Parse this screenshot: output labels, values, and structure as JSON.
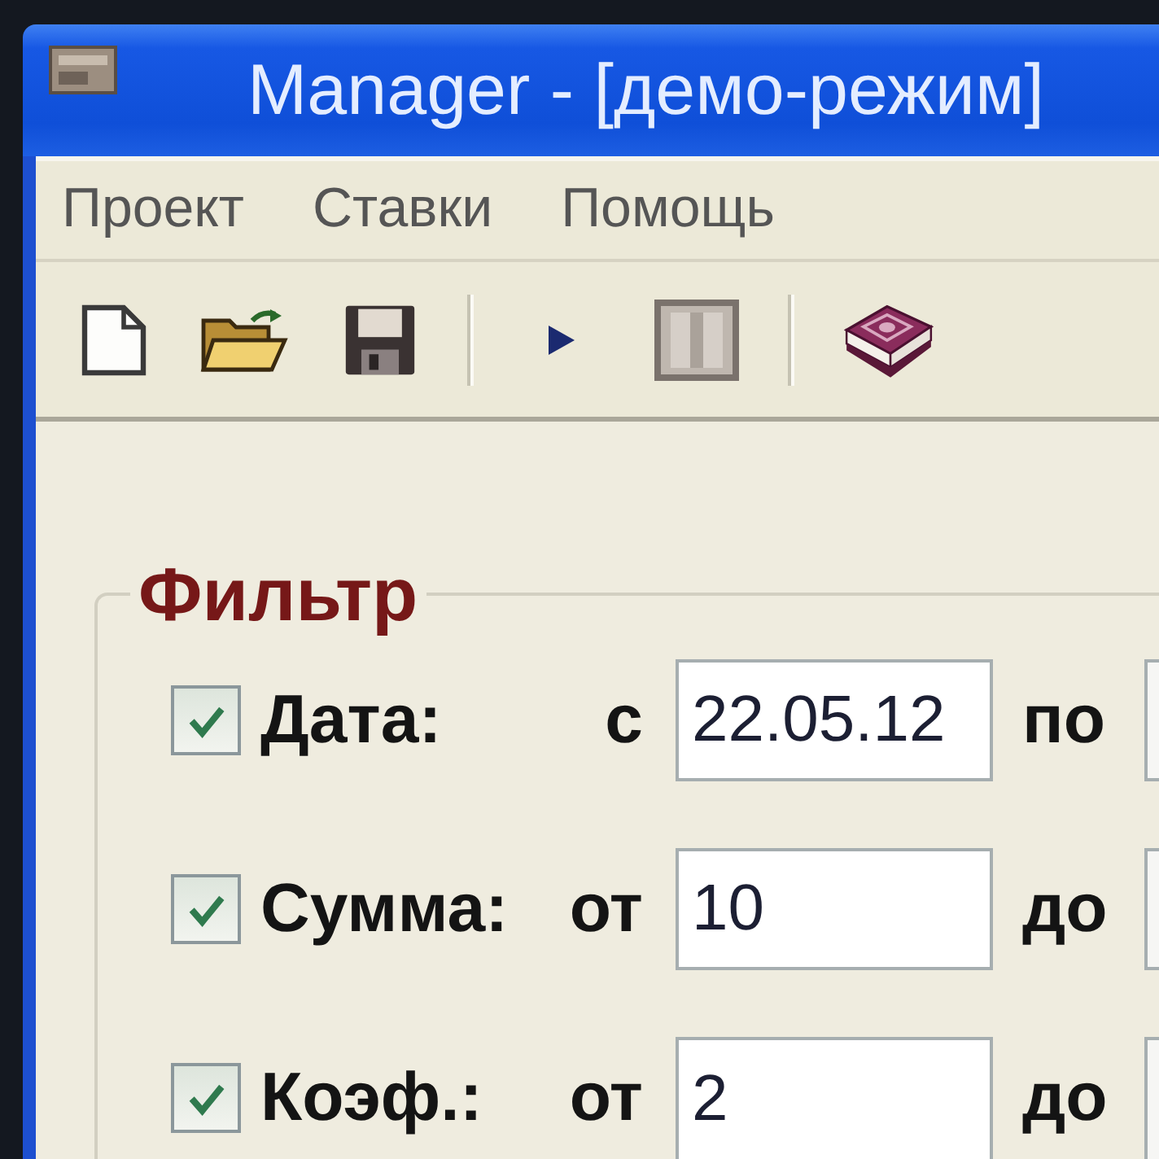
{
  "window": {
    "title": "Manager - [демо-режим]"
  },
  "menu": [
    {
      "label": "Проект"
    },
    {
      "label": "Ставки"
    },
    {
      "label": "Помощь"
    }
  ],
  "filter": {
    "title": "Фильтр",
    "rows": [
      {
        "label": "Дата:",
        "checked": true,
        "from_label": "с",
        "from_value": "22.05.12",
        "to_label": "по"
      },
      {
        "label": "Сумма:",
        "checked": true,
        "from_label": "от",
        "from_value": "10",
        "to_label": "до"
      },
      {
        "label": "Коэф.:",
        "checked": true,
        "from_label": "от",
        "from_value": "2",
        "to_label": "до"
      }
    ]
  }
}
